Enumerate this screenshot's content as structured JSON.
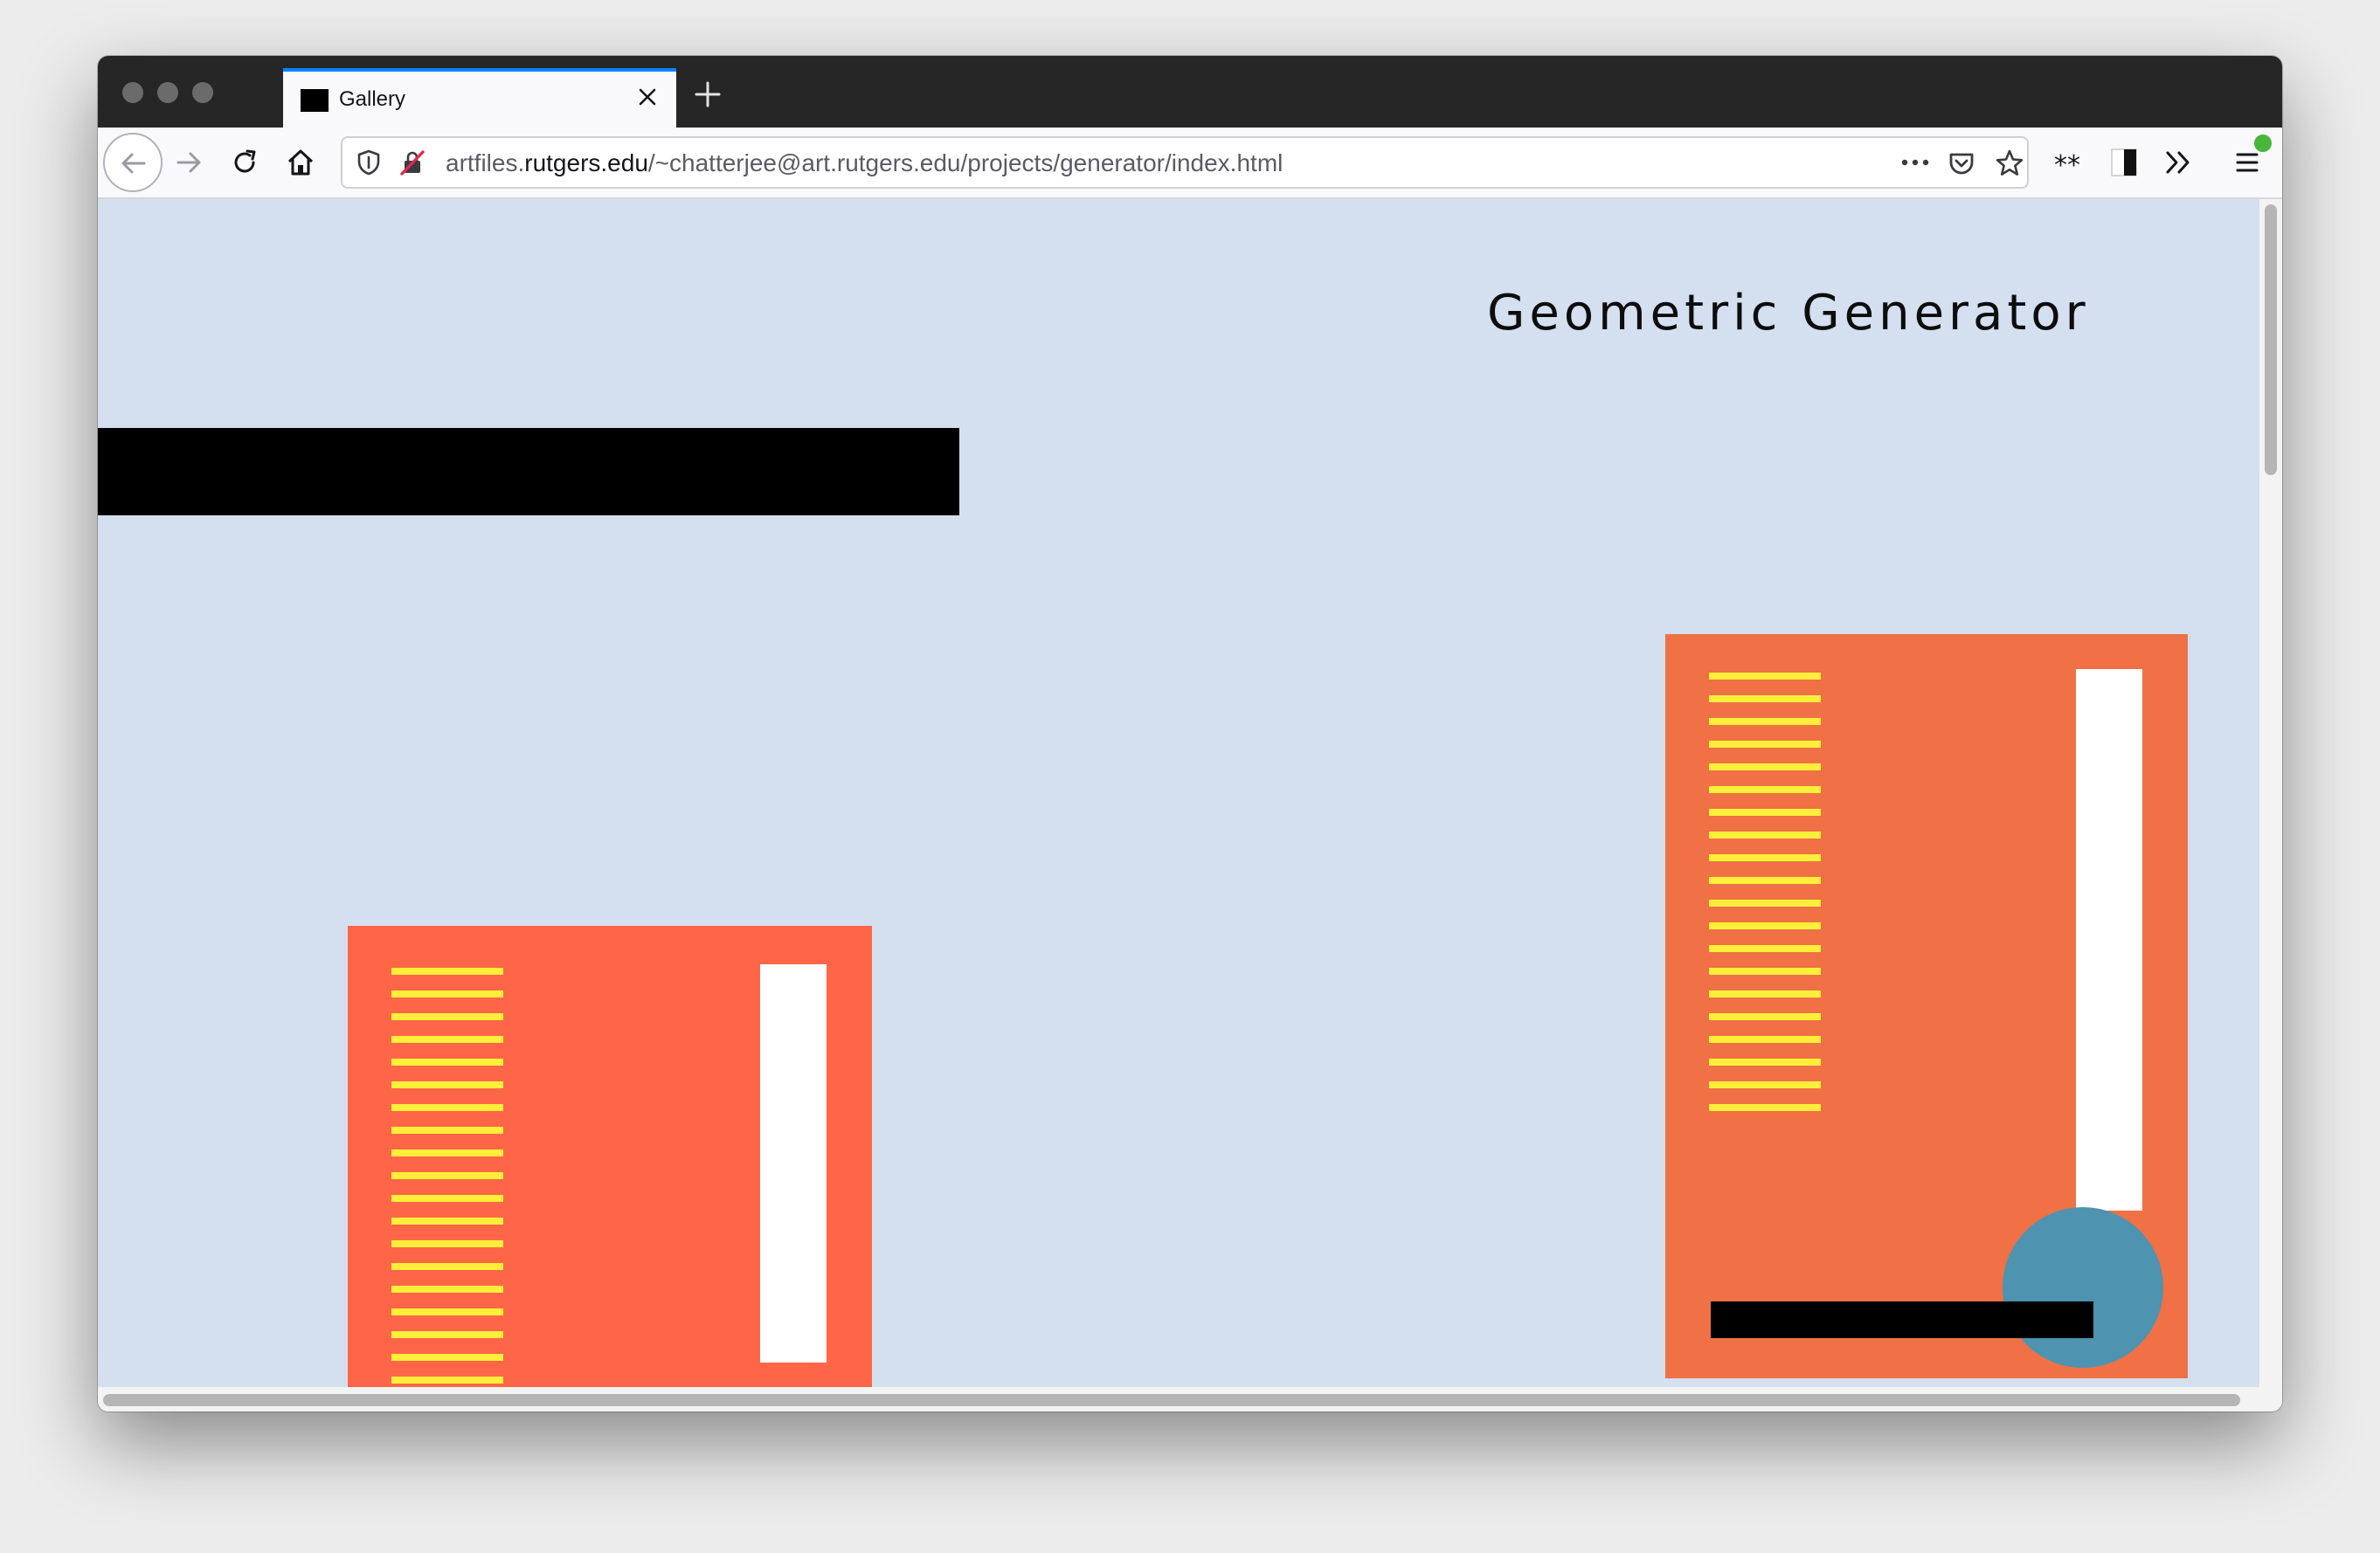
{
  "browser": {
    "window_buttons": [
      "close",
      "minimize",
      "zoom"
    ],
    "tab": {
      "title": "Gallery",
      "favicon": "black-square",
      "close_icon": "close-icon"
    },
    "new_tab_icon": "plus-icon",
    "toolbar": {
      "nav_icons": [
        "back-arrow-icon",
        "forward-arrow-icon",
        "reload-icon",
        "home-icon"
      ],
      "right_icons": [
        "page-actions-ellipsis-icon",
        "pocket-icon",
        "bookmark-star-icon",
        "extension-asterisks-icon",
        "extension-contrast-icon",
        "overflow-chevron-icon",
        "hamburger-menu-icon"
      ],
      "update_badge_color": "#48b63b"
    },
    "address_bar": {
      "security_icons": [
        "tracking-shield-icon",
        "insecure-lock-icon"
      ],
      "url_prefix": "artfiles.",
      "url_host": "rutgers.edu",
      "url_path": "/~chatterjee@art.rutgers.edu/projects/generator/index.html"
    }
  },
  "page": {
    "background": "#d4dff0",
    "title": "Geometric Generator",
    "shapes": {
      "black_bar_color": "#000000",
      "left_panel": {
        "color": "#ff6647",
        "stripe_color": "#ffef3a",
        "stripe_count": 19,
        "bar_color": "#ffffff"
      },
      "right_panel": {
        "color": "#ef7145",
        "stripe_color": "#ffef3a",
        "stripe_count": 20,
        "bar_color": "#ffffff",
        "circle_color": "#4e93b0",
        "overlay_bar_color": "#000000"
      }
    }
  }
}
